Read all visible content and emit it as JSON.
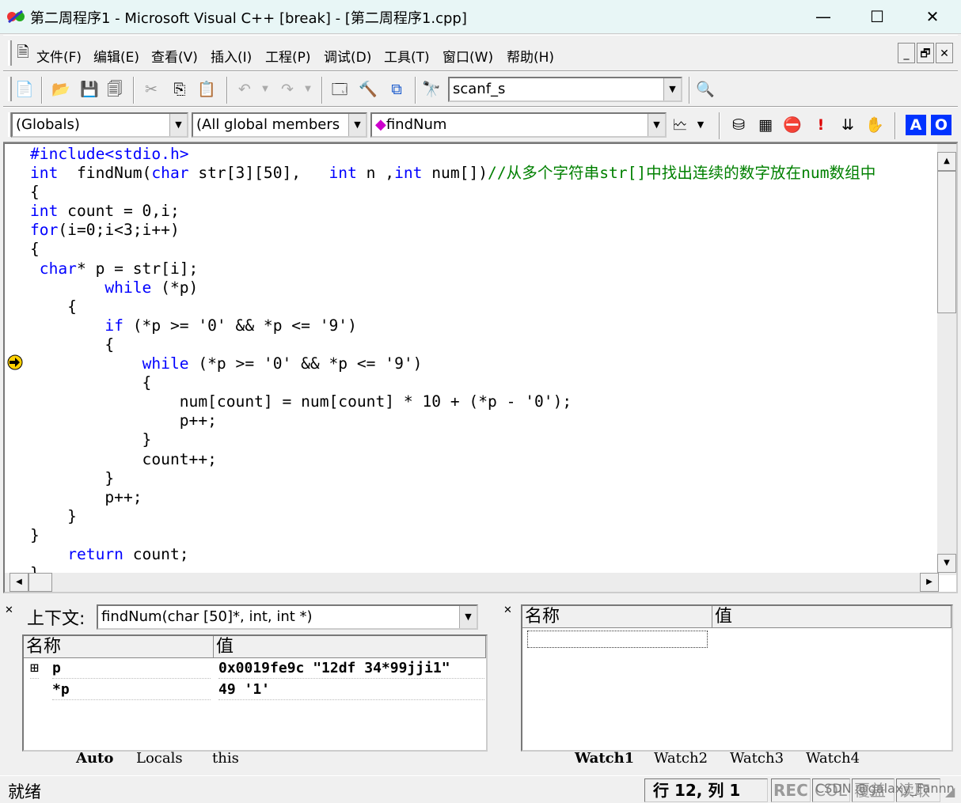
{
  "window": {
    "title": "第二周程序1 - Microsoft Visual C++ [break] - [第二周程序1.cpp]",
    "minimize": "—",
    "maximize": "☐",
    "close": "✕"
  },
  "menu": {
    "items": [
      "文件(F)",
      "编辑(E)",
      "查看(V)",
      "插入(I)",
      "工程(P)",
      "调试(D)",
      "工具(T)",
      "窗口(W)",
      "帮助(H)"
    ],
    "mdi": [
      "_",
      "🗗",
      "✕"
    ]
  },
  "toolbar": {
    "find_value": "scanf_s"
  },
  "wizardbar": {
    "class_combo": "(Globals)",
    "members_combo": "(All global members",
    "function_combo": "findNum",
    "mode_a": "A",
    "mode_o": "O"
  },
  "editor": {
    "lines": [
      [
        [
          "#include<stdio.h>",
          "kw"
        ]
      ],
      [
        [
          "int",
          "kw"
        ],
        [
          "  findNum(",
          ""
        ],
        [
          "char",
          "kw"
        ],
        [
          " str[3][50],   ",
          ""
        ],
        [
          "int",
          "kw"
        ],
        [
          " n ,",
          ""
        ],
        [
          "int",
          "kw"
        ],
        [
          " num[])",
          ""
        ],
        [
          "//从多个字符串str[]中找出连续的数字放在num数组中",
          "cm"
        ]
      ],
      [
        [
          "{",
          ""
        ]
      ],
      [
        [
          "int",
          "kw"
        ],
        [
          " count = 0,i;",
          ""
        ]
      ],
      [
        [
          "for",
          "kw"
        ],
        [
          "(i=0;i<3;i++)",
          ""
        ]
      ],
      [
        [
          "{",
          ""
        ]
      ],
      [
        [
          " ",
          ""
        ],
        [
          "char",
          "kw"
        ],
        [
          "* p = str[i];",
          ""
        ]
      ],
      [
        [
          "        ",
          ""
        ],
        [
          "while",
          "kw"
        ],
        [
          " (*p)",
          ""
        ]
      ],
      [
        [
          "    {",
          ""
        ]
      ],
      [
        [
          "        ",
          ""
        ],
        [
          "if",
          "kw"
        ],
        [
          " (*p >= '0' && *p <= '9')",
          ""
        ]
      ],
      [
        [
          "        {",
          ""
        ]
      ],
      [
        [
          "            ",
          ""
        ],
        [
          "while",
          "kw"
        ],
        [
          " (*p >= '0' && *p <= '9')",
          ""
        ]
      ],
      [
        [
          "            {",
          ""
        ]
      ],
      [
        [
          "                num[count] = num[count] * 10 + (*p - '0');",
          ""
        ]
      ],
      [
        [
          "                p++;",
          ""
        ]
      ],
      [
        [
          "            }",
          ""
        ]
      ],
      [
        [
          "            count++;",
          ""
        ]
      ],
      [
        [
          "        }",
          ""
        ]
      ],
      [
        [
          "        p++;",
          ""
        ]
      ],
      [
        [
          "    }",
          ""
        ]
      ],
      [
        [
          "}",
          ""
        ]
      ],
      [
        [
          "    ",
          ""
        ],
        [
          "return",
          "kw"
        ],
        [
          " count;",
          ""
        ]
      ],
      [
        [
          "}",
          ""
        ]
      ]
    ],
    "current_line": 12
  },
  "variables": {
    "context_label": "上下文:",
    "context_value": "findNum(char [50]*, int, int *)",
    "col_name": "名称",
    "col_value": "值",
    "rows": [
      {
        "name": "p",
        "value": "0x0019fe9c \"12df 34*99jji1\"",
        "expand": "⊞"
      },
      {
        "name": "*p",
        "value": "49 '1'"
      }
    ],
    "tabs": [
      "Auto",
      "Locals",
      "this"
    ]
  },
  "watch": {
    "col_name": "名称",
    "col_value": "值",
    "tabs": [
      "Watch1",
      "Watch2",
      "Watch3",
      "Watch4"
    ]
  },
  "status": {
    "ready": "就绪",
    "position": "行 12, 列 1",
    "rec": "REC",
    "col": "COL",
    "ovr": "覆盖",
    "read": "读取",
    "watermark": "CSDN @galaxy_Fannn"
  },
  "colors": {
    "keyword": "#0000ff",
    "comment": "#008000",
    "title_bg": "#e8f6f6"
  }
}
